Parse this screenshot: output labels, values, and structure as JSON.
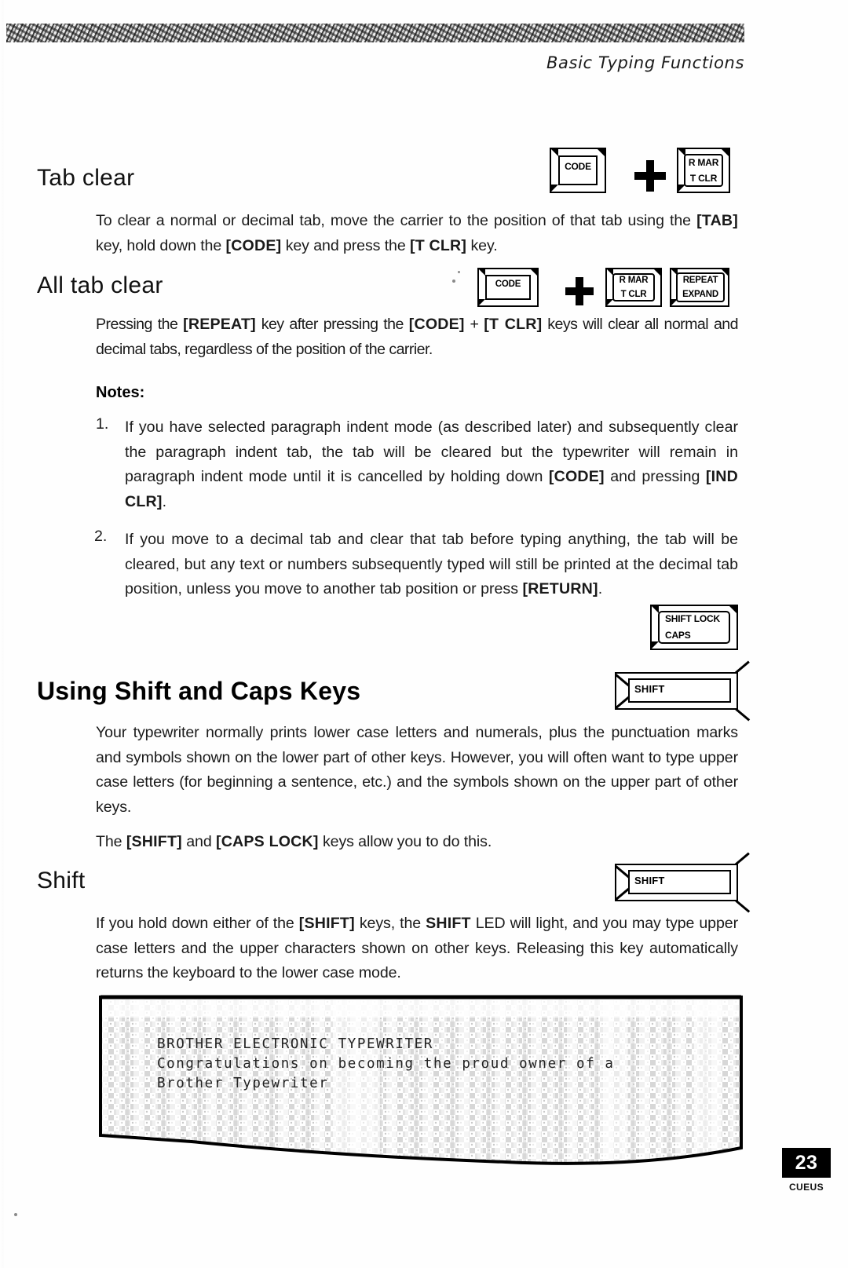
{
  "header": {
    "running_head": "Basic Typing Functions"
  },
  "sections": {
    "tab_clear": {
      "heading": "Tab clear",
      "paragraph_parts": [
        {
          "t": "To clear a normal or decimal tab, move the carrier to the position of that tab using the ",
          "b": false
        },
        {
          "t": "[TAB]",
          "b": true
        },
        {
          "t": " key, hold down the ",
          "b": false
        },
        {
          "t": "[CODE]",
          "b": true
        },
        {
          "t": " key and press the ",
          "b": false
        },
        {
          "t": "[T CLR]",
          "b": true
        },
        {
          "t": " key.",
          "b": false
        }
      ]
    },
    "all_tab_clear": {
      "heading": "All tab clear",
      "paragraph_parts": [
        {
          "t": "Pressing the ",
          "b": false
        },
        {
          "t": "[REPEAT]",
          "b": true
        },
        {
          "t": " key after pressing the ",
          "b": false
        },
        {
          "t": "[CODE]",
          "b": true
        },
        {
          "t": " + ",
          "b": false
        },
        {
          "t": "[T CLR]",
          "b": true
        },
        {
          "t": " keys will clear all normal and decimal tabs, regardless of the position of the carrier.",
          "b": false
        }
      ]
    },
    "notes": {
      "label": "Notes:",
      "items": [
        {
          "number": "1.",
          "parts": [
            {
              "t": "If you have selected paragraph indent mode (as described later) and subsequently clear the paragraph indent tab, the tab will be cleared but the typewriter will remain in paragraph indent mode until it is cancelled by holding down ",
              "b": false
            },
            {
              "t": "[CODE]",
              "b": true
            },
            {
              "t": " and pressing ",
              "b": false
            },
            {
              "t": "[IND CLR]",
              "b": true
            },
            {
              "t": ".",
              "b": false
            }
          ]
        },
        {
          "number": "2.",
          "parts": [
            {
              "t": "If you move to a decimal tab and clear that tab before typing anything, the tab will be cleared, but any text or numbers subsequently typed will still be printed at the decimal tab position, unless you move to another tab position or press ",
              "b": false
            },
            {
              "t": "[RETURN]",
              "b": true
            },
            {
              "t": ".",
              "b": false
            }
          ]
        }
      ]
    },
    "using_shift_caps": {
      "heading": "Using Shift and Caps Keys",
      "paragraph1_parts": [
        {
          "t": "Your typewriter normally prints lower case letters and numerals, plus the punctuation marks and symbols shown on the lower part of other keys. However, you will often want to type upper case letters (for beginning a sentence, etc.) and the symbols shown on the upper part of other keys.",
          "b": false
        }
      ],
      "paragraph2_parts": [
        {
          "t": "The ",
          "b": false
        },
        {
          "t": "[SHIFT]",
          "b": true
        },
        {
          "t": " and ",
          "b": false
        },
        {
          "t": "[CAPS LOCK]",
          "b": true
        },
        {
          "t": " keys allow you to do this.",
          "b": false
        }
      ]
    },
    "shift": {
      "heading": "Shift",
      "paragraph_parts": [
        {
          "t": "If you hold down either of the ",
          "b": false
        },
        {
          "t": "[SHIFT]",
          "b": true
        },
        {
          "t": " keys, the ",
          "b": false
        },
        {
          "t": "SHIFT",
          "b": true
        },
        {
          "t": " LED will light, and you may type upper case letters and the upper characters shown on other keys. Releasing this key automatically returns the keyboard to the lower case mode.",
          "b": false
        }
      ]
    }
  },
  "key_diagrams": {
    "tab_clear_keys": {
      "code_key": {
        "label_top": "CODE",
        "label_bottom": ""
      },
      "operator": "plus",
      "tclr_key": {
        "label_top": "R MAR",
        "label_bottom": "T CLR"
      }
    },
    "all_tab_clear_keys": {
      "code_key": {
        "label_top": "CODE",
        "label_bottom": ""
      },
      "operator": "plus",
      "tclr_key": {
        "label_top": "R MAR",
        "label_bottom": "T CLR"
      },
      "repeat_key": {
        "label_top": "REPEAT",
        "label_bottom": "EXPAND"
      }
    },
    "caps_key": {
      "label_top": "SHIFT LOCK",
      "label_bottom": "CAPS"
    },
    "shift_key_upper": {
      "label": "SHIFT"
    },
    "shift_key_lower": {
      "label": "SHIFT"
    }
  },
  "illustration": {
    "typed_lines": [
      "BROTHER ELECTRONIC TYPEWRITER",
      "Congratulations on becoming the proud owner of a",
      "Brother Typewriter"
    ]
  },
  "footer": {
    "page_number": "23",
    "code": "CUEUS"
  },
  "colors": {
    "ink": "#111111",
    "paper": "#ffffff",
    "badge_bg": "#000000",
    "badge_fg": "#ffffff"
  }
}
